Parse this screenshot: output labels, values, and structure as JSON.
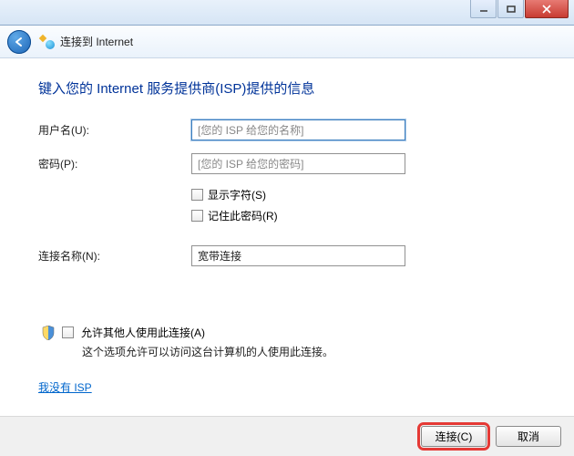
{
  "header": {
    "title": "连接到 Internet"
  },
  "main": {
    "title": "键入您的 Internet 服务提供商(ISP)提供的信息"
  },
  "fields": {
    "username": {
      "label": "用户名(U):",
      "placeholder": "[您的 ISP 给您的名称]",
      "value": ""
    },
    "password": {
      "label": "密码(P):",
      "placeholder": "[您的 ISP 给您的密码]",
      "value": ""
    },
    "connection": {
      "label": "连接名称(N):",
      "value": "宽带连接"
    }
  },
  "checkboxes": {
    "show_chars": "显示字符(S)",
    "remember": "记住此密码(R)",
    "allow_others": "允许其他人使用此连接(A)",
    "allow_desc": "这个选项允许可以访问这台计算机的人使用此连接。"
  },
  "link": {
    "no_isp": "我没有 ISP"
  },
  "buttons": {
    "connect": "连接(C)",
    "cancel": "取消"
  }
}
